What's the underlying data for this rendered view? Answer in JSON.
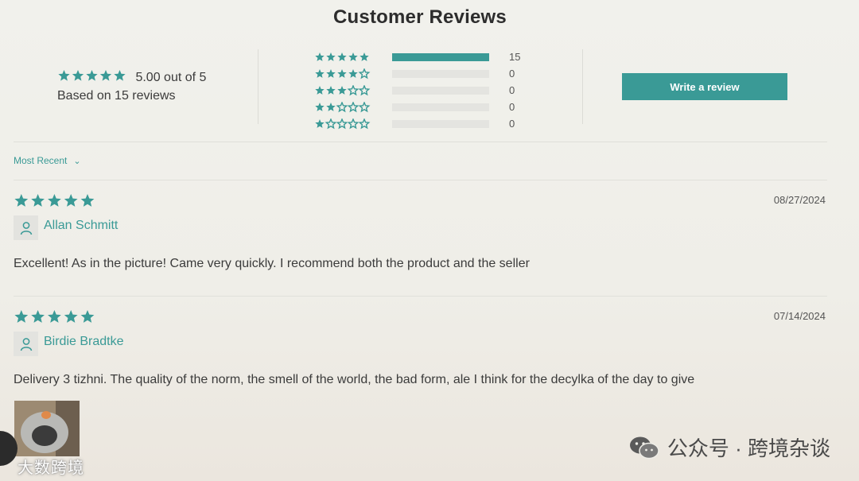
{
  "page": {
    "title": "Customer Reviews"
  },
  "summary": {
    "rating": 5,
    "average_text": "5.00 out of 5",
    "based_on_text": "Based on 15 reviews"
  },
  "histogram": [
    {
      "stars": 5,
      "count": 15,
      "count_label": "15",
      "fraction": 1.0
    },
    {
      "stars": 4,
      "count": 0,
      "count_label": "0",
      "fraction": 0
    },
    {
      "stars": 3,
      "count": 0,
      "count_label": "0",
      "fraction": 0
    },
    {
      "stars": 2,
      "count": 0,
      "count_label": "0",
      "fraction": 0
    },
    {
      "stars": 1,
      "count": 0,
      "count_label": "0",
      "fraction": 0
    }
  ],
  "actions": {
    "write_review_label": "Write a review"
  },
  "sort": {
    "selected": "Most Recent"
  },
  "reviews": [
    {
      "rating": 5,
      "date": "08/27/2024",
      "author": "Allan Schmitt",
      "text": "Excellent! As in the picture! Came very quickly. I recommend both the product and the seller"
    },
    {
      "rating": 5,
      "date": "07/14/2024",
      "author": "Birdie Bradtke",
      "text": "Delivery 3 tizhni. The quality of the norm, the smell of the world, the bad form, ale I think for the decylka of the day to give"
    }
  ],
  "watermarks": {
    "right": "公众号 · 跨境杂谈",
    "left": "大数跨境"
  },
  "colors": {
    "accent": "#3a9a96",
    "bar_track": "#e4e4e0",
    "text": "#3b3b3b"
  },
  "icons": {
    "star": "star-icon",
    "user": "user-icon",
    "chevron": "chevron-down-icon",
    "wechat": "wechat-icon"
  }
}
